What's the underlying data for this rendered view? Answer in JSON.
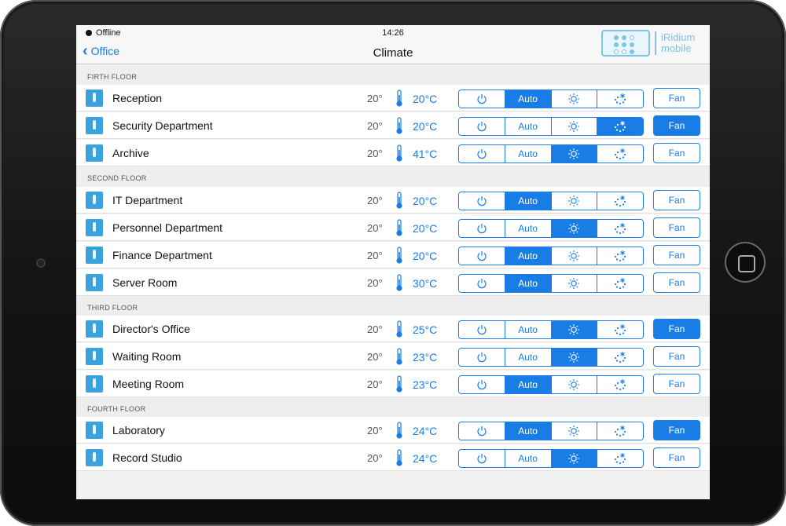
{
  "status": {
    "carrier": "Offline",
    "time": "14:26"
  },
  "nav": {
    "back_label": "Office",
    "title": "Climate"
  },
  "logo": {
    "line1": "iRidium",
    "line2": "mobile"
  },
  "colors": {
    "accent": "#1a7de6",
    "icon": "#3aa3dd",
    "logo": "#7fc3e6"
  },
  "mode_labels": {
    "auto": "Auto",
    "fan": "Fan"
  },
  "icons": {
    "room": "thermostat-tile-icon",
    "thermometer": "thermometer-icon",
    "off": "power-icon",
    "heat": "sun-icon",
    "cool": "snowflake-icon"
  },
  "sections": [
    {
      "title": "FIRTH FLOOR",
      "rooms": [
        {
          "name": "Reception",
          "setpoint": "20°",
          "temp": "20°C",
          "mode": "auto",
          "fan": false
        },
        {
          "name": "Security Department",
          "setpoint": "20°",
          "temp": "20°C",
          "mode": "cool",
          "fan": true
        },
        {
          "name": "Archive",
          "setpoint": "20°",
          "temp": "41°C",
          "mode": "heat",
          "fan": false
        }
      ]
    },
    {
      "title": "SECOND FLOOR",
      "rooms": [
        {
          "name": "IT Department",
          "setpoint": "20°",
          "temp": "20°C",
          "mode": "auto",
          "fan": false
        },
        {
          "name": "Personnel Department",
          "setpoint": "20°",
          "temp": "20°C",
          "mode": "heat",
          "fan": false
        },
        {
          "name": "Finance Department",
          "setpoint": "20°",
          "temp": "20°C",
          "mode": "auto",
          "fan": false
        },
        {
          "name": "Server Room",
          "setpoint": "20°",
          "temp": "30°C",
          "mode": "auto",
          "fan": false
        }
      ]
    },
    {
      "title": "THIRD FLOOR",
      "rooms": [
        {
          "name": "Director's Office",
          "setpoint": "20°",
          "temp": "25°C",
          "mode": "heat",
          "fan": true
        },
        {
          "name": "Waiting Room",
          "setpoint": "20°",
          "temp": "23°C",
          "mode": "heat",
          "fan": false
        },
        {
          "name": "Meeting Room",
          "setpoint": "20°",
          "temp": "23°C",
          "mode": "auto",
          "fan": false
        }
      ]
    },
    {
      "title": "FOURTH FLOOR",
      "rooms": [
        {
          "name": "Laboratory",
          "setpoint": "20°",
          "temp": "24°C",
          "mode": "auto",
          "fan": true
        },
        {
          "name": "Record Studio",
          "setpoint": "20°",
          "temp": "24°C",
          "mode": "heat",
          "fan": false
        }
      ]
    }
  ]
}
